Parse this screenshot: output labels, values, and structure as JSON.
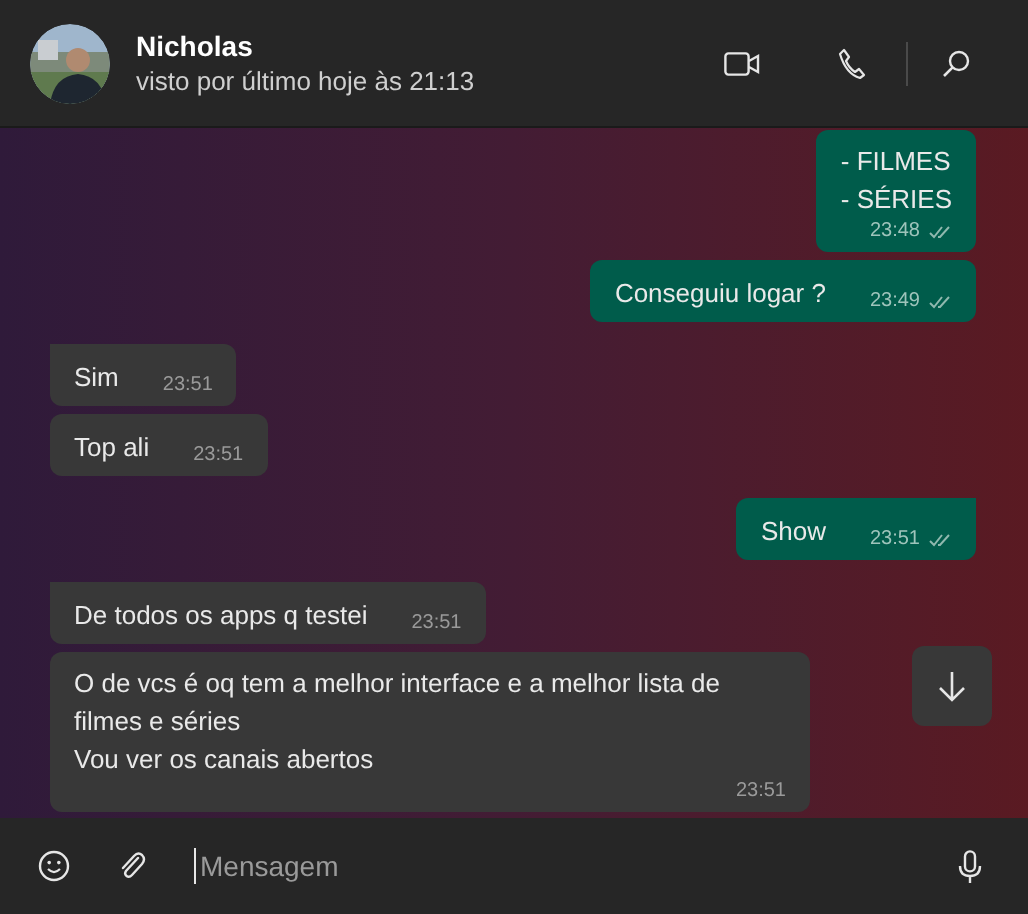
{
  "header": {
    "name": "Nicholas",
    "status": "visto por último hoje às 21:13"
  },
  "messages": [
    {
      "kind": "sent",
      "tail": false,
      "lines": [
        "- FILMES",
        "- SÉRIES"
      ],
      "time": "23:48",
      "ticks": true
    },
    {
      "kind": "sent",
      "tail": false,
      "lines": [
        "Conseguiu logar ?"
      ],
      "time": "23:49",
      "ticks": true
    },
    {
      "kind": "received",
      "tail": true,
      "lines": [
        "Sim"
      ],
      "time": "23:51",
      "ticks": false
    },
    {
      "kind": "received",
      "tail": false,
      "lines": [
        "Top ali"
      ],
      "time": "23:51",
      "ticks": false
    },
    {
      "kind": "sent",
      "tail": true,
      "lines": [
        "Show"
      ],
      "time": "23:51",
      "ticks": true
    },
    {
      "kind": "received",
      "tail": true,
      "lines": [
        "De todos os apps q testei"
      ],
      "time": "23:51",
      "ticks": false
    },
    {
      "kind": "received",
      "tail": false,
      "lines": [
        "O de vcs é oq tem a melhor interface e a melhor lista de filmes e séries",
        "Vou ver os canais abertos"
      ],
      "time": "23:51",
      "ticks": false
    }
  ],
  "composer": {
    "placeholder": "Mensagem"
  }
}
